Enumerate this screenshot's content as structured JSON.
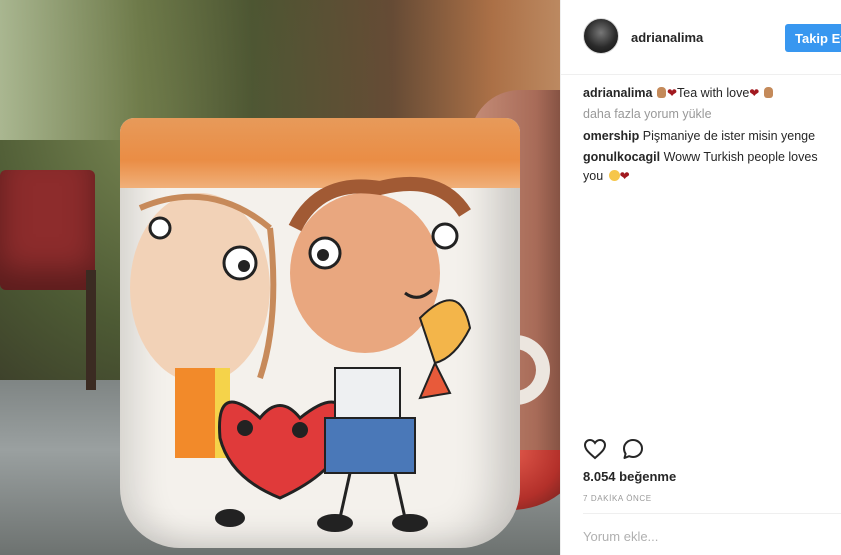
{
  "post": {
    "author": "adrianalima",
    "follow_label": "Takip Et",
    "caption_user": "adrianalima",
    "caption_text": "Tea with love",
    "load_more_label": "daha fazla yorum yükle",
    "comments": [
      {
        "user": "omership",
        "text": "Pişmaniye de ister misin yenge"
      },
      {
        "user": "gonulkocagil",
        "text": "Woww Turkish people loves you"
      }
    ],
    "likes_label": "8.054 beğenme",
    "timestamp": "7 DAKİKA ÖNCE",
    "comment_placeholder": "Yorum ekle..."
  },
  "icons": {
    "like": "heart-outline-icon",
    "comment": "speech-bubble-icon"
  },
  "colors": {
    "accent": "#3897f0",
    "heart_emoji": "#a1191f",
    "muted_text": "#999999"
  }
}
